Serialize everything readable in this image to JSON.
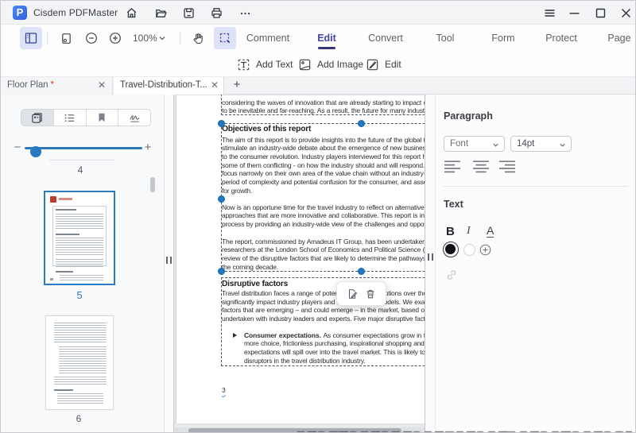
{
  "window": {
    "title": "Cisdem PDFMaster",
    "logo_letter": "P",
    "titlebar_icons": [
      "home",
      "open-file",
      "save",
      "print",
      "more"
    ],
    "window_controls": [
      "menu",
      "minimize",
      "maximize",
      "close"
    ]
  },
  "toolbar": {
    "zoom_value": "100%",
    "tool_icons": [
      "toggle-sidebar",
      "page-view",
      "zoom-out",
      "zoom-in",
      "hand-tool",
      "select-tool"
    ],
    "ribbon_tabs": [
      {
        "label": "Comment",
        "active": false
      },
      {
        "label": "Edit",
        "active": true
      },
      {
        "label": "Convert",
        "active": false
      },
      {
        "label": "Tool",
        "active": false
      },
      {
        "label": "Form",
        "active": false
      },
      {
        "label": "Protect",
        "active": false
      },
      {
        "label": "Page",
        "active": false
      }
    ],
    "subtools": [
      {
        "icon": "add-text",
        "label": "Add Text"
      },
      {
        "icon": "add-image",
        "label": "Add Image"
      },
      {
        "icon": "edit",
        "label": "Edit"
      }
    ]
  },
  "doc_tabs": {
    "tabs": [
      {
        "label": "Floor Plan",
        "modified_mark": "*",
        "active": false
      },
      {
        "label": "Travel-Distribution-T...",
        "modified_mark": "",
        "active": true
      }
    ],
    "new_tab_label": "+"
  },
  "sidebar": {
    "view_tabs": [
      "thumbnails",
      "outline",
      "bookmarks",
      "signature"
    ],
    "zoom_slider": {
      "minus_label": "−",
      "plus_label": "+",
      "value_position": 0.08
    },
    "partial_page_number_above": "4",
    "thumbnails": [
      {
        "page_number": "5",
        "selected": true
      },
      {
        "page_number": "6",
        "selected": false
      }
    ]
  },
  "document": {
    "intro_lines": [
      "considering the waves of innovation that are already starting to impact on the industry, seem",
      "to be inevitable and far-reaching. As a result, the future for many industry players is unclear."
    ],
    "block1": {
      "heading": "Objectives of this report",
      "para1": [
        "The aim of this report is to provide insights into the future of the global travel industry and to",
        "stimulate an industry-wide debate about the emergence of new business models adapted",
        "to the consumer revolution. Industry players interviewed for this report hold diverse views -",
        "some of them conflicting - on how the industry should and will respond. Thus, many players",
        "focus narrowly on their own area of the value chain without an industry-wide view, creating a",
        "period of complexity and potential confusion for the consumer, and associated opportunities",
        "for growth."
      ],
      "para2": [
        "Now is an opportune time for the travel industry to reflect on alternative scenarios and new",
        "approaches that are more innovative and collaborative. This report is intended to aid this",
        "process by providing an industry-wide view of the challenges and opportunities ahead."
      ],
      "para3": [
        "The report, commissioned by Amadeus IT Group, has been undertaken independently by",
        "researchers at the London School of Economics and Political Science (LSE). It provides a",
        "review of the disruptive factors that are likely to determine the pathways of change over",
        "the coming decade."
      ]
    },
    "block2": {
      "heading": "Disruptive factors",
      "para": [
        "Travel distribution faces a range of potentially major disruptions over the coming decade that could",
        "significantly impact industry players and their business models. We examine below those",
        "factors that are emerging – and could emerge – in the market, based on research",
        "undertaken with industry leaders and experts. Five major disruptive factors are identified:"
      ],
      "bullet_lead": "Consumer expectations.",
      "bullet_lines": [
        "As consumer expectations grow in the wider digital world of",
        "more choice, frictionless purchasing, inspirational shopping and personalisation, these",
        "expectations will spill over into the travel market. This is likely to be one of the major",
        "disruptors in the travel distribution industry."
      ],
      "footer_page_number": "3"
    },
    "popover_icons": [
      "edit-annotation",
      "delete-annotation"
    ]
  },
  "panel": {
    "paragraph_section_label": "Paragraph",
    "font_value": "Font",
    "font_size_value": "14pt",
    "align_icons": [
      "align-left",
      "align-center",
      "align-right"
    ],
    "text_section_label": "Text",
    "bold_label": "B",
    "italic_label": "I",
    "font_color_label": "A",
    "swatches": [
      "black-selected",
      "white",
      "add-color"
    ],
    "link_icon": "link"
  },
  "colors": {
    "accent_indigo": "#4447a5",
    "selection_blue": "#2079c2",
    "titlebar_bg": "#f3f4f6",
    "doc_area_bg": "#e9eaec",
    "logo_blue": "#3b6fe8",
    "thumb_logo_red": "#bf3a2b"
  }
}
